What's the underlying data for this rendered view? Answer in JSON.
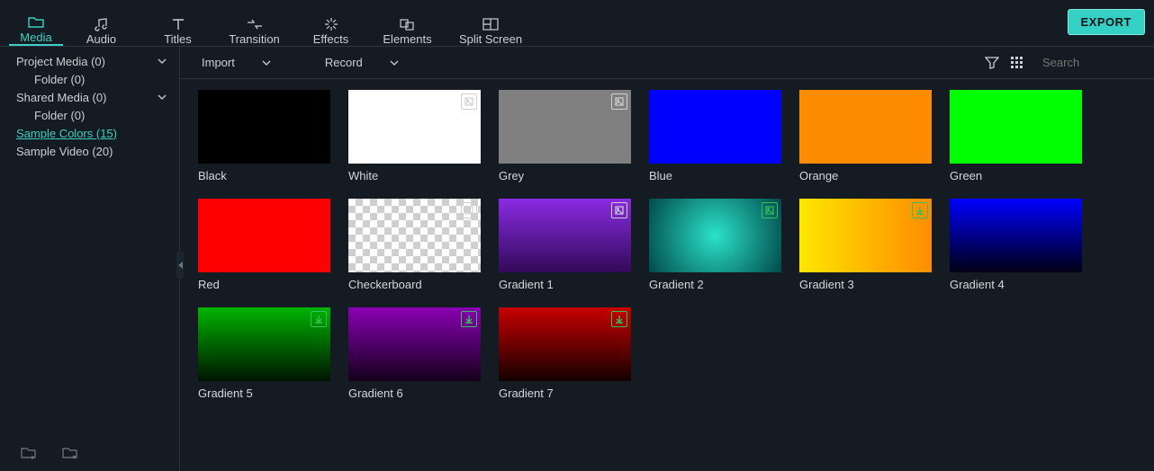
{
  "toolbar": {
    "tabs": [
      "Media",
      "Audio",
      "Titles",
      "Transition",
      "Effects",
      "Elements",
      "Split Screen"
    ],
    "export_label": "EXPORT"
  },
  "subbar": {
    "import_label": "Import",
    "record_label": "Record",
    "search_placeholder": "Search"
  },
  "sidebar": {
    "items": [
      {
        "label": "Project Media (0)",
        "indent": false,
        "chev": true
      },
      {
        "label": "Folder (0)",
        "indent": true,
        "chev": false
      },
      {
        "label": "Shared Media (0)",
        "indent": false,
        "chev": true
      },
      {
        "label": "Folder (0)",
        "indent": true,
        "chev": false
      },
      {
        "label": "Sample Colors (15)",
        "indent": false,
        "chev": false,
        "selected": true
      },
      {
        "label": "Sample Video (20)",
        "indent": false,
        "chev": false
      }
    ]
  },
  "thumbs": [
    {
      "label": "Black",
      "bg": "#000000"
    },
    {
      "label": "White",
      "bg": "#ffffff",
      "badge": "img"
    },
    {
      "label": "Grey",
      "bg": "#808080",
      "badge": "img"
    },
    {
      "label": "Blue",
      "bg": "#0000ff"
    },
    {
      "label": "Orange",
      "bg": "#ff8c00"
    },
    {
      "label": "Green",
      "bg": "#00ff00"
    },
    {
      "label": "Red",
      "bg": "#ff0000"
    },
    {
      "label": "Checkerboard",
      "checker": true,
      "badge": "img"
    },
    {
      "label": "Gradient 1",
      "grad": "linear-gradient(to bottom,#8a2be2,#320a5a)",
      "badge": "img"
    },
    {
      "label": "Gradient 2",
      "grad": "radial-gradient(circle at 50% 50%,#2be2c9,#004a49)",
      "badge": "img2"
    },
    {
      "label": "Gradient 3",
      "grad": "linear-gradient(to right,#ffe600,#ff8c00)",
      "badge": "dl"
    },
    {
      "label": "Gradient 4",
      "grad": "linear-gradient(to bottom,#0000ff,#000014)"
    },
    {
      "label": "Gradient 5",
      "grad": "linear-gradient(to bottom,#00b400,#001400)",
      "badge": "dl"
    },
    {
      "label": "Gradient 6",
      "grad": "linear-gradient(to bottom,#8a00b4,#14001a)",
      "badge": "dl"
    },
    {
      "label": "Gradient 7",
      "grad": "linear-gradient(to bottom,#c80000,#140000)",
      "badge": "dl"
    }
  ]
}
